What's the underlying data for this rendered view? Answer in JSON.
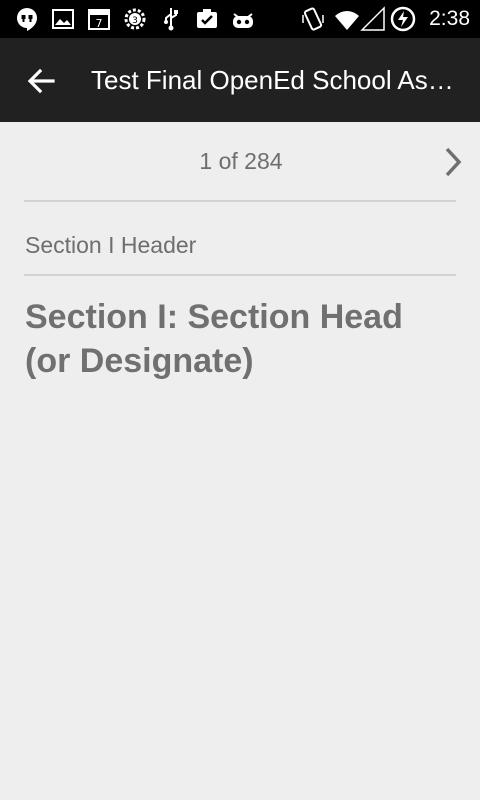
{
  "status_bar": {
    "time": "2:38",
    "icons": [
      "hangouts-icon",
      "image-icon",
      "calendar-icon",
      "gear-badge-icon",
      "usb-icon",
      "clipboard-check-icon",
      "android-icon",
      "vibrate-icon",
      "wifi-icon",
      "signal-icon",
      "battery-charging-icon"
    ]
  },
  "app_bar": {
    "title": "Test Final OpenEd School Assessment",
    "back_icon": "arrow-back-icon"
  },
  "pager": {
    "text": "1 of 284",
    "next_icon": "chevron-right-icon"
  },
  "content": {
    "section_label": "Section I Header",
    "question_text": "Section I: Section Head (or Designate)"
  },
  "colors": {
    "status_bar_bg": "#000000",
    "app_bar_bg": "#212121",
    "page_bg": "#eeeeee",
    "text_gray": "#6e6e6e",
    "divider": "#d2d2d2"
  }
}
